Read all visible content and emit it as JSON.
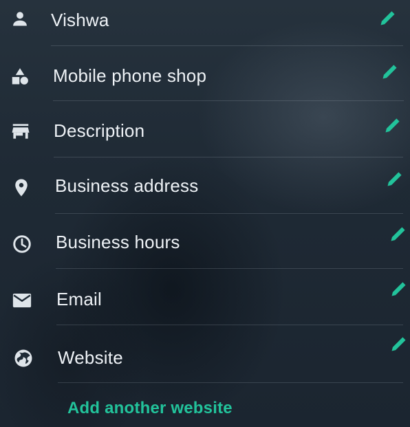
{
  "colors": {
    "background": "#1f2b36",
    "text": "#eef2f6",
    "icon": "#dfe5ea",
    "accent": "#22c39b"
  },
  "fields": [
    {
      "label": "Vishwa",
      "icon": "person-icon"
    },
    {
      "label": "Mobile phone shop",
      "icon": "category-icon"
    },
    {
      "label": "Description",
      "icon": "store-icon"
    },
    {
      "label": "Business address",
      "icon": "location-pin-icon"
    },
    {
      "label": "Business hours",
      "icon": "clock-icon"
    },
    {
      "label": "Email",
      "icon": "email-icon"
    },
    {
      "label": "Website",
      "icon": "globe-icon"
    }
  ],
  "add_website_link": "Add another website"
}
